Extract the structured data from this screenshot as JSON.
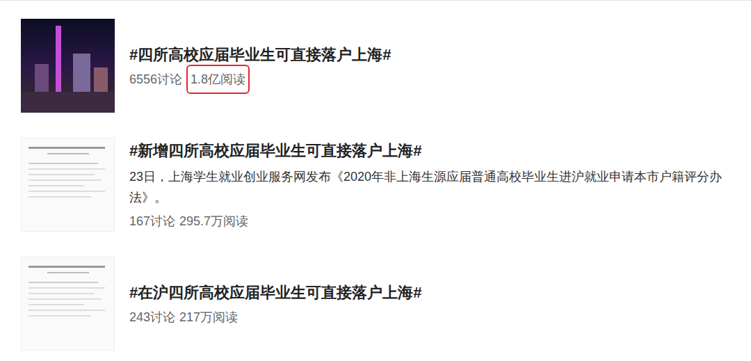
{
  "topics": [
    {
      "title": "#四所高校应届毕业生可直接落户上海#",
      "description": "",
      "discussions": "6556讨论",
      "reads": "1.8亿阅读",
      "reads_highlighted": true,
      "thumbnail": {
        "kind": "photo"
      }
    },
    {
      "title": "#新增四所高校应届毕业生可直接落户上海#",
      "description": "23日，上海学生就业创业服务网发布《2020年非上海生源应届普通高校毕业生进沪就业申请本市户籍评分办法》。",
      "discussions": "167讨论",
      "reads": "295.7万阅读",
      "reads_highlighted": false,
      "thumbnail": {
        "kind": "document"
      }
    },
    {
      "title": "#在沪四所高校应届毕业生可直接落户上海#",
      "description": "",
      "discussions": "243讨论",
      "reads": "217万阅读",
      "reads_highlighted": false,
      "thumbnail": {
        "kind": "document"
      }
    }
  ]
}
